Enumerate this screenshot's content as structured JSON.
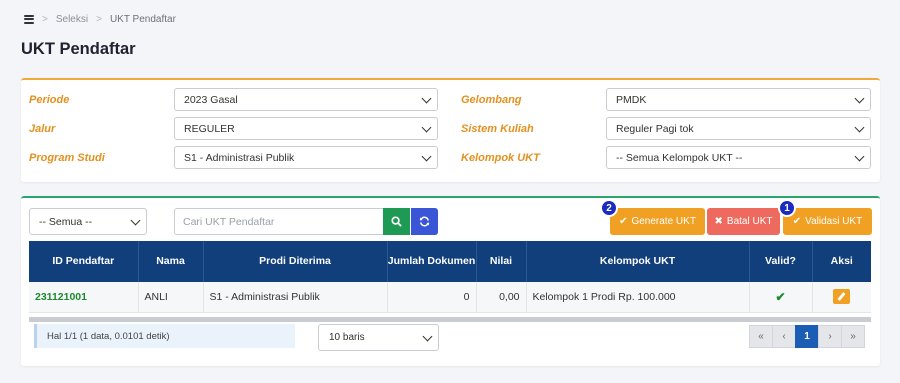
{
  "breadcrumb": {
    "items": [
      "Seleksi",
      "UKT Pendaftar"
    ],
    "separator": ">"
  },
  "page": {
    "title": "UKT Pendaftar"
  },
  "filters": {
    "periode": {
      "label": "Periode",
      "value": "2023 Gasal"
    },
    "gelombang": {
      "label": "Gelombang",
      "value": "PMDK"
    },
    "jalur": {
      "label": "Jalur",
      "value": "REGULER"
    },
    "sistem_kuliah": {
      "label": "Sistem Kuliah",
      "value": "Reguler Pagi tok"
    },
    "program_studi": {
      "label": "Program Studi",
      "value": "S1 - Administrasi Publik"
    },
    "kelompok_ukt": {
      "label": "Kelompok UKT",
      "value": "-- Semua Kelompok UKT --"
    }
  },
  "toolbar": {
    "status_select": "-- Semua --",
    "search_placeholder": "Cari UKT Pendaftar",
    "generate_label": "Generate UKT",
    "generate_badge": "2",
    "batal_label": "Batal UKT",
    "validasi_label": "Validasi UKT",
    "validasi_badge": "1"
  },
  "table": {
    "headers": [
      "ID Pendaftar",
      "Nama",
      "Prodi Diterima",
      "Jumlah Dokumen",
      "Nilai",
      "Kelompok UKT",
      "Valid?",
      "Aksi"
    ],
    "rows": [
      {
        "id": "231121001",
        "nama": "ANLI",
        "prodi": "S1 - Administrasi Publik",
        "jumlah_dokumen": "0",
        "nilai": "0,00",
        "kelompok": "Kelompok 1 Prodi Rp. 100.000",
        "valid": "✔"
      }
    ]
  },
  "footer": {
    "info": "Hal 1/1 (1 data, 0.0101 detik)",
    "rows_per_page": "10 baris",
    "pager": {
      "first": "«",
      "prev": "‹",
      "current": "1",
      "next": "›",
      "last": "»"
    }
  },
  "colors": {
    "accent_orange": "#f0a023",
    "header_navy": "#103f7c",
    "danger": "#ee6a5e",
    "success": "#1e8a2f",
    "badge_blue": "#1b2bbf"
  }
}
